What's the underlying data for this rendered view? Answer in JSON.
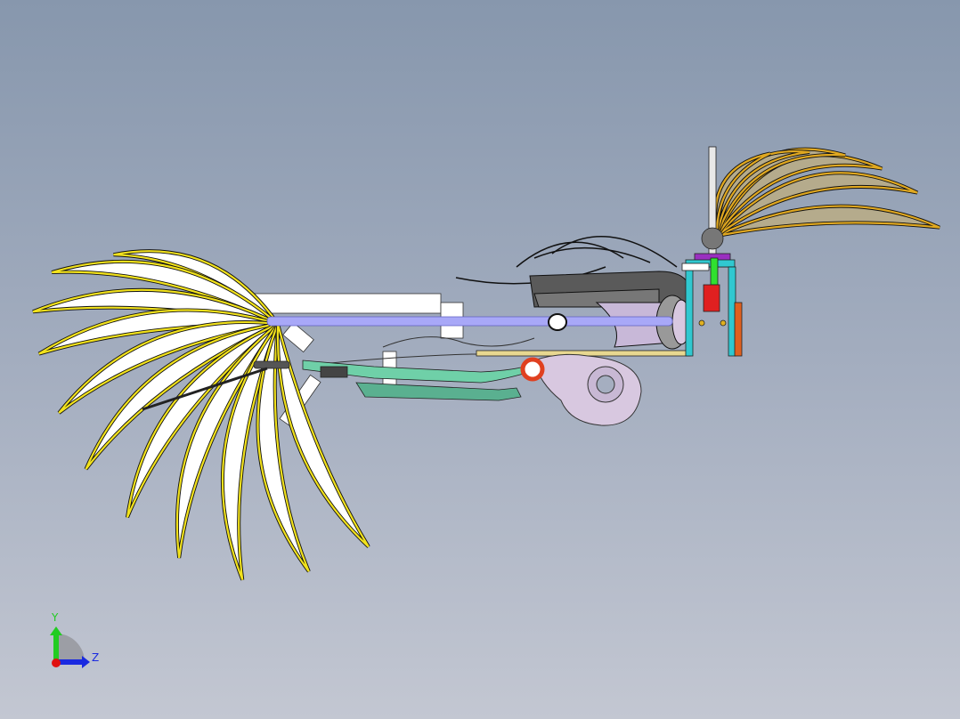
{
  "viewport": {
    "background_top": "#8797ad",
    "background_bottom": "#c3c7d2"
  },
  "triad": {
    "y_label": "Y",
    "z_label": "Z",
    "y_color": "#22cc22",
    "z_color": "#1a2ae0",
    "x_color": "#e01010"
  },
  "model": {
    "feather_fill": "#ffffff",
    "feather_edge": "#f2e21c",
    "wing_fill": "#b5ab8c",
    "wing_edge": "#e0a820",
    "rod_color": "#a8a8f8",
    "nacelle_color": "#5a5a5a",
    "torus_color": "#d8c8e0",
    "arm_color": "#6fd0a8"
  }
}
